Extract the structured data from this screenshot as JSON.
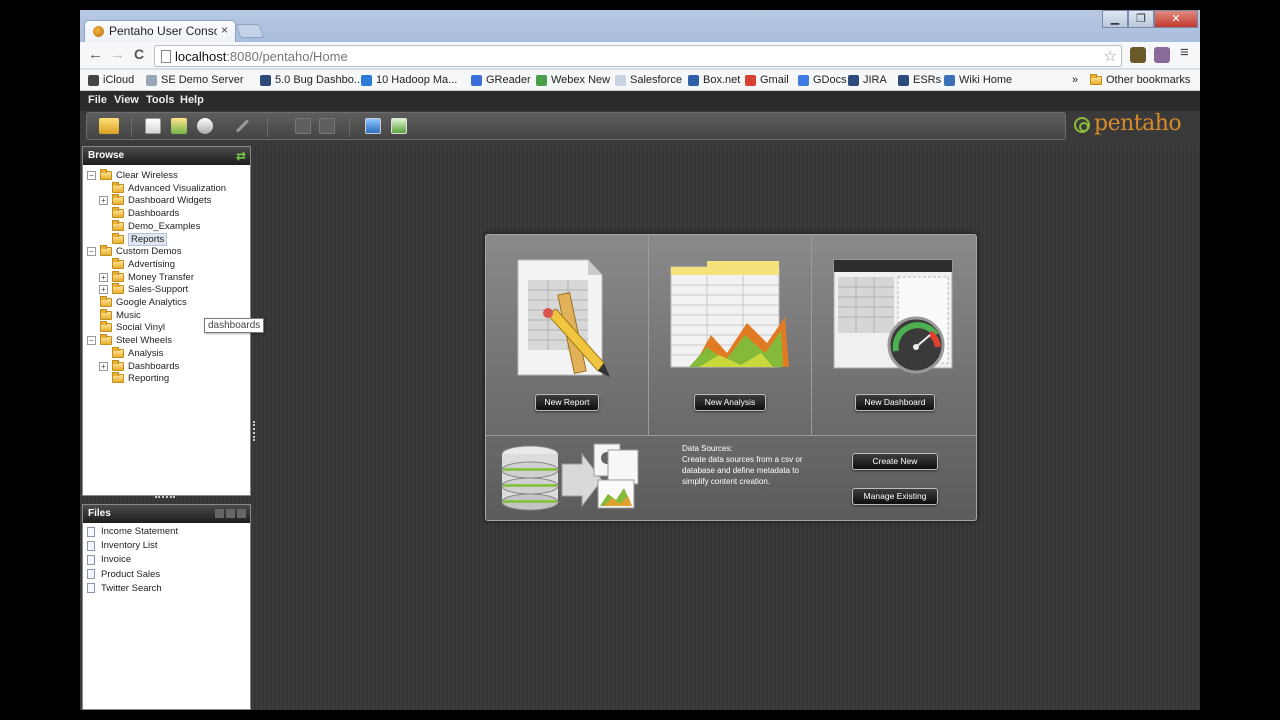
{
  "browser": {
    "tab_title": "Pentaho User Consol",
    "tab_close": "×",
    "url_host": "localhost",
    "url_rest": ":8080/pentaho/Home",
    "window_buttons": [
      "▁",
      "❐",
      "✕"
    ],
    "nav": {
      "back": "←",
      "forward": "→",
      "reload": "C"
    },
    "star": "☆",
    "bookmarks": [
      {
        "label": "iCloud",
        "icon": "apple-icon",
        "color": "#444444"
      },
      {
        "label": "SE Demo Server",
        "icon": "page-icon",
        "color": "#9aa6b8"
      },
      {
        "label": "5.0 Bug Dashbo...",
        "icon": "bug-icon",
        "color": "#2d4a7a"
      },
      {
        "label": "10 Hadoop Ma...",
        "icon": "pin-icon",
        "color": "#2b7bd6"
      },
      {
        "label": "GReader",
        "icon": "reader-icon",
        "color": "#3a6fd8"
      },
      {
        "label": "Webex New",
        "icon": "globe-icon",
        "color": "#4aa04a"
      },
      {
        "label": "Salesforce",
        "icon": "cloud-icon",
        "color": "#c8d3e3"
      },
      {
        "label": "Box.net",
        "icon": "box-icon",
        "color": "#2f5fa8"
      },
      {
        "label": "Gmail",
        "icon": "mail-icon",
        "color": "#d84030"
      },
      {
        "label": "GDocs",
        "icon": "docs-icon",
        "color": "#3d7be0"
      },
      {
        "label": "JIRA",
        "icon": "jira-icon",
        "color": "#2d4a7a"
      },
      {
        "label": "ESRs",
        "icon": "esr-icon",
        "color": "#2d4a7a"
      },
      {
        "label": "Wiki Home",
        "icon": "wiki-icon",
        "color": "#3b6fb8"
      }
    ],
    "bookmarks_overflow": "»",
    "other_bookmarks": "Other bookmarks"
  },
  "app": {
    "menu": [
      "File",
      "View",
      "Tools",
      "Help"
    ],
    "logo_text": "pentaho",
    "browse": {
      "title": "Browse",
      "tree": [
        {
          "label": "Clear Wireless",
          "level": 0,
          "expander": "−"
        },
        {
          "label": "Advanced Visualization",
          "level": 1,
          "expander": ""
        },
        {
          "label": "Dashboard Widgets",
          "level": 1,
          "expander": "+"
        },
        {
          "label": "Dashboards",
          "level": 1,
          "expander": ""
        },
        {
          "label": "Demo_Examples",
          "level": 1,
          "expander": ""
        },
        {
          "label": "Reports",
          "level": 1,
          "expander": "",
          "selected": true
        },
        {
          "label": "Custom Demos",
          "level": 0,
          "expander": "−"
        },
        {
          "label": "Advertising",
          "level": 1,
          "expander": ""
        },
        {
          "label": "Money Transfer",
          "level": 1,
          "expander": "+"
        },
        {
          "label": "Sales-Support",
          "level": 1,
          "expander": "+"
        },
        {
          "label": "Google Analytics",
          "level": 0,
          "expander": ""
        },
        {
          "label": "Music",
          "level": 0,
          "expander": ""
        },
        {
          "label": "Social Vinyl",
          "level": 0,
          "expander": ""
        },
        {
          "label": "Steel Wheels",
          "level": 0,
          "expander": "−"
        },
        {
          "label": "Analysis",
          "level": 1,
          "expander": ""
        },
        {
          "label": "Dashboards",
          "level": 1,
          "expander": "+"
        },
        {
          "label": "Reporting",
          "level": 1,
          "expander": ""
        }
      ],
      "tooltip": "dashboards"
    },
    "files": {
      "title": "Files",
      "items": [
        "Income Statement",
        "Inventory List",
        "Invoice",
        "Product Sales",
        "Twitter Search"
      ]
    },
    "launch": {
      "new_report": "New Report",
      "new_analysis": "New Analysis",
      "new_dashboard": "New Dashboard",
      "ds_title": "Data Sources:",
      "ds_desc": "Create data sources from a csv or database and define metadata to simplify content creation.",
      "create_new": "Create New",
      "manage_existing": "Manage Existing"
    }
  }
}
